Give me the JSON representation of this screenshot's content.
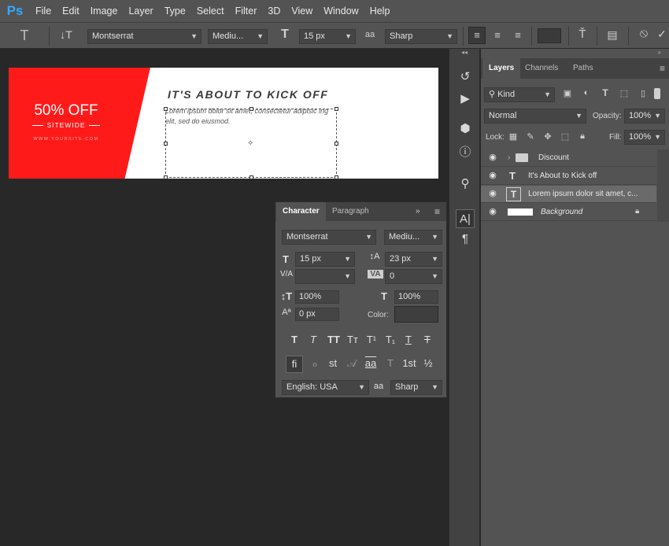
{
  "app": {
    "logo": "Ps"
  },
  "menu": [
    "File",
    "Edit",
    "Image",
    "Layer",
    "Type",
    "Select",
    "Filter",
    "3D",
    "View",
    "Window",
    "Help"
  ],
  "options_bar": {
    "font_family": "Montserrat",
    "font_style": "Mediu...",
    "font_size": "15 px",
    "antialias_icon": "aa",
    "antialias": "Sharp"
  },
  "canvas": {
    "discount": "50% OFF",
    "sitewide": "SITEWIDE",
    "url": "WWW.YOURSITE.COM",
    "headline": "IT'S ABOUT TO KICK OFF",
    "lorem": "Lorem ipsum dolor sit amet, consectetur adipisic ing elit, sed do eiusmod.",
    "accent_color": "#ff1a1a"
  },
  "layers_panel": {
    "tabs": [
      "Layers",
      "Channels",
      "Paths"
    ],
    "filter_kind": "Kind",
    "blend_mode": "Normal",
    "opacity_label": "Opacity:",
    "opacity_value": "100%",
    "lock_label": "Lock:",
    "fill_label": "Fill:",
    "fill_value": "100%",
    "layers": [
      {
        "name": "Discount",
        "type": "folder-icon"
      },
      {
        "name": "It's About to Kick off",
        "type": "text-layer-icon"
      },
      {
        "name": "Lorem ipsum dolor sit amet, c...",
        "type": "text-layer-icon"
      },
      {
        "name": "Background",
        "type": "lock-icon"
      }
    ]
  },
  "character_panel": {
    "tabs": [
      "Character",
      "Paragraph"
    ],
    "font_family": "Montserrat",
    "font_style": "Mediu...",
    "font_size": "15 px",
    "leading": "23 px",
    "kerning": "",
    "tracking": "0",
    "vertical_scale": "100%",
    "horizontal_scale": "100%",
    "baseline_shift": "0 px",
    "color_label": "Color:",
    "language": "English: USA",
    "antialias_icon": "aa",
    "antialias": "Sharp",
    "style_buttons": [
      "T",
      "T",
      "TT",
      "Tт",
      "T¹",
      "T₁",
      "T",
      "T"
    ],
    "opentype_buttons": [
      "fi",
      "ℴ",
      "st",
      "𝒜",
      "aa",
      "T",
      "1st",
      "½"
    ]
  }
}
